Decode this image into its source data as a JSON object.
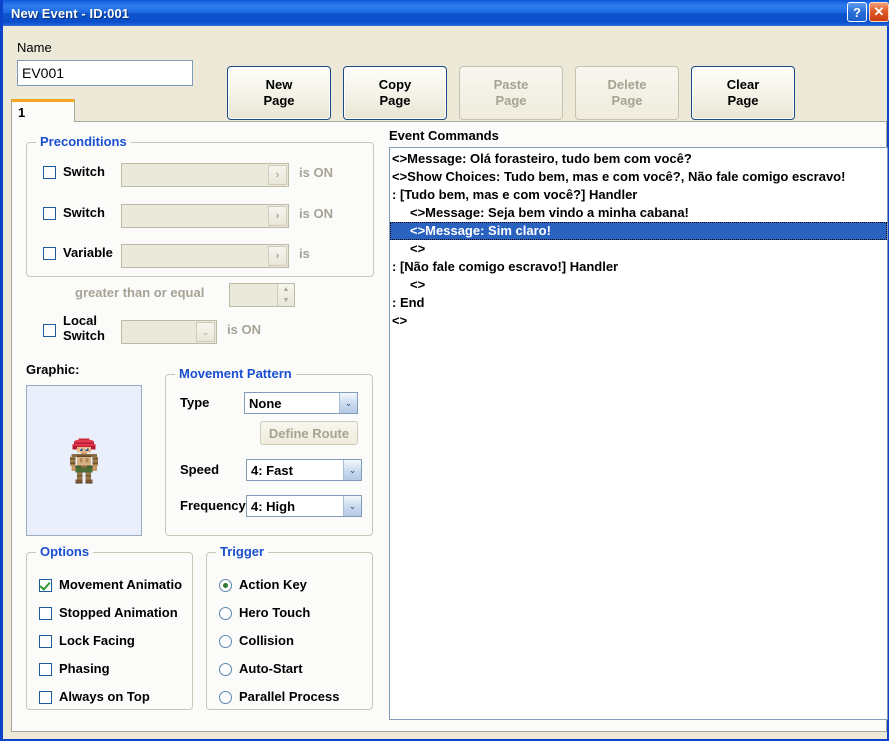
{
  "window": {
    "title": "New Event - ID:001",
    "help_button": "?",
    "close_button": "✕"
  },
  "colors": {
    "titlebar_blue": "#1565d8",
    "group_title_blue": "#1a4fcf",
    "selection_blue": "#2a62bf",
    "tab_active_orange": "#f5a623",
    "dialog_bg": "#ece9d8",
    "panel_bg": "#fbfbfa",
    "disabled_text": "#a7a392",
    "check_green": "#2e9a35"
  },
  "toolbar": {
    "name_label": "Name",
    "name_value": "EV001",
    "buttons": [
      {
        "line1": "New",
        "line2": "Page",
        "enabled": true
      },
      {
        "line1": "Copy",
        "line2": "Page",
        "enabled": true
      },
      {
        "line1": "Paste",
        "line2": "Page",
        "enabled": false
      },
      {
        "line1": "Delete",
        "line2": "Page",
        "enabled": false
      },
      {
        "line1": "Clear",
        "line2": "Page",
        "enabled": true
      }
    ]
  },
  "tabs": [
    {
      "label": "1",
      "active": true
    }
  ],
  "preconditions": {
    "title": "Preconditions",
    "switch1": {
      "label": "Switch",
      "checked": false,
      "value": "",
      "suffix": "is ON",
      "expand_glyph": "›"
    },
    "switch2": {
      "label": "Switch",
      "checked": false,
      "value": "",
      "suffix": "is ON",
      "expand_glyph": "›"
    },
    "variable": {
      "label": "Variable",
      "checked": false,
      "value": "",
      "suffix": "is",
      "expand_glyph": "›"
    },
    "comparison": {
      "label": "greater than or equal",
      "value": ""
    },
    "local_switch": {
      "label_line1": "Local",
      "label_line2": "Switch",
      "checked": false,
      "value": "",
      "suffix": "is ON",
      "expand_glyph": "⌄"
    }
  },
  "graphic": {
    "label": "Graphic:",
    "sprite_name": "character-sprite"
  },
  "movement": {
    "title": "Movement Pattern",
    "type_label": "Type",
    "type_value": "None",
    "define_route_label": "Define Route",
    "define_route_enabled": false,
    "speed_label": "Speed",
    "speed_value": "4: Fast",
    "frequency_label": "Frequency",
    "frequency_value": "4: High",
    "dropdown_glyph": "⌄"
  },
  "options": {
    "title": "Options",
    "items": [
      {
        "label": "Movement Animatio",
        "checked": true
      },
      {
        "label": "Stopped Animation",
        "checked": false
      },
      {
        "label": "Lock Facing",
        "checked": false
      },
      {
        "label": "Phasing",
        "checked": false
      },
      {
        "label": "Always on Top",
        "checked": false
      }
    ]
  },
  "trigger": {
    "title": "Trigger",
    "items": [
      {
        "label": "Action Key",
        "selected": true
      },
      {
        "label": "Hero Touch",
        "selected": false
      },
      {
        "label": "Collision",
        "selected": false
      },
      {
        "label": "Auto-Start",
        "selected": false
      },
      {
        "label": "Parallel Process",
        "selected": false
      }
    ]
  },
  "event_commands": {
    "label": "Event Commands",
    "rows": [
      {
        "text": "<>Message: Olá forasteiro, tudo bem com você?",
        "indent": 0,
        "selected": false
      },
      {
        "text": "<>Show Choices: Tudo bem, mas e com você?, Não fale comigo escravo!",
        "indent": 0,
        "selected": false
      },
      {
        "text": ":  [Tudo bem, mas e com você?] Handler",
        "indent": 0,
        "selected": false
      },
      {
        "text": "<>Message: Seja bem vindo a minha cabana!",
        "indent": 2,
        "selected": false
      },
      {
        "text": "<>Message: Sim claro!",
        "indent": 2,
        "selected": true
      },
      {
        "text": "<>",
        "indent": 2,
        "selected": false
      },
      {
        "text": ":  [Não fale comigo escravo!] Handler",
        "indent": 0,
        "selected": false
      },
      {
        "text": "<>",
        "indent": 2,
        "selected": false
      },
      {
        "text": ":  End",
        "indent": 0,
        "selected": false
      },
      {
        "text": "<>",
        "indent": 0,
        "selected": false
      }
    ]
  }
}
